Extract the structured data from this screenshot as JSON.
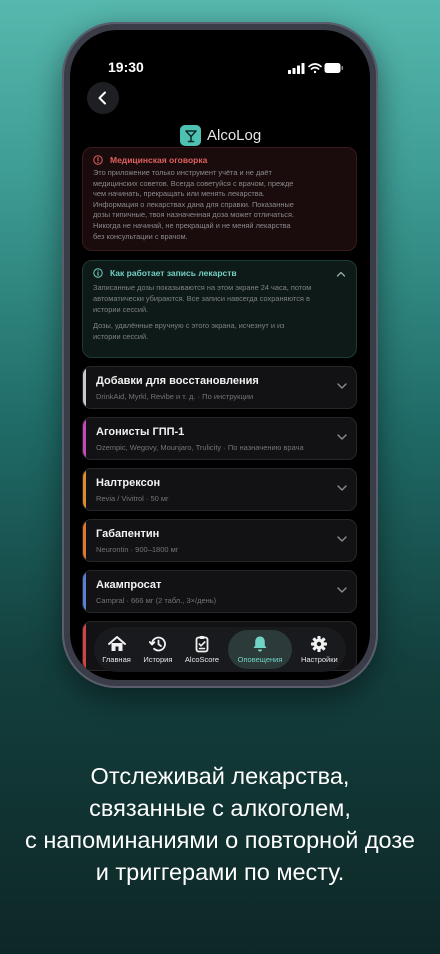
{
  "status": {
    "time": "19:30"
  },
  "app": {
    "name": "AlcoLog"
  },
  "disclaimer": {
    "title": "Медицинская оговорка",
    "lines": [
      "Это приложение только инструмент учёта и не даёт",
      "медицинских советов. Всегда советуйся с врачом, прежде",
      "чем начинать, прекращать или менять лекарства.",
      "Информация о лекарствах дана для справки. Показанные",
      "дозы типичные, твоя назначенная доза может отличаться.",
      "Никогда не начинай, не прекращай и не меняй лекарства",
      "без консультации с врачом."
    ]
  },
  "info": {
    "title": "Как работает запись лекарств",
    "paragraph1_lines": [
      "Записанные дозы показываются на этом экране 24 часа, потом",
      "автоматически убираются. Все записи навсегда сохраняются в",
      "истории сессий."
    ],
    "paragraph2_lines": [
      "Дозы, удалённые вручную с этого экрана, исчезнут и из",
      "истории сессий."
    ]
  },
  "medications": [
    {
      "name": "Добавки для восстановления",
      "subtitle": "DrinkAid, Myrkl, Revibe и т. д. · По инструкции",
      "accent": "#c9c9cc"
    },
    {
      "name": "Агонисты ГПП-1",
      "subtitle": "Ozempic, Wegovy, Mounjaro, Trulicity · По назначению врача",
      "accent": "#c648b8"
    },
    {
      "name": "Налтрексон",
      "subtitle": "Revia / Vivitrol · 50 мг",
      "accent": "#e08a2c"
    },
    {
      "name": "Габапентин",
      "subtitle": "Neurontin · 900–1800 мг",
      "accent": "#e0762c"
    },
    {
      "name": "Акампросат",
      "subtitle": "Campral · 666 мг (2 табл., 3×/день)",
      "accent": "#5b7fd6"
    }
  ],
  "tabs": [
    {
      "label": "Главная",
      "icon": "home-icon"
    },
    {
      "label": "История",
      "icon": "history-icon"
    },
    {
      "label": "AlcoScore",
      "icon": "clipboard-icon"
    },
    {
      "label": "Оповещения",
      "icon": "bell-icon"
    },
    {
      "label": "Настройки",
      "icon": "gear-icon"
    }
  ],
  "colors": {
    "accent": "#4fc1b3",
    "warning": "#e0615e"
  },
  "caption": {
    "lines": [
      "Отслеживай лекарства,",
      "связанные с алкоголем,",
      "с напоминаниями о повторной дозе",
      "и триггерами по месту."
    ]
  }
}
